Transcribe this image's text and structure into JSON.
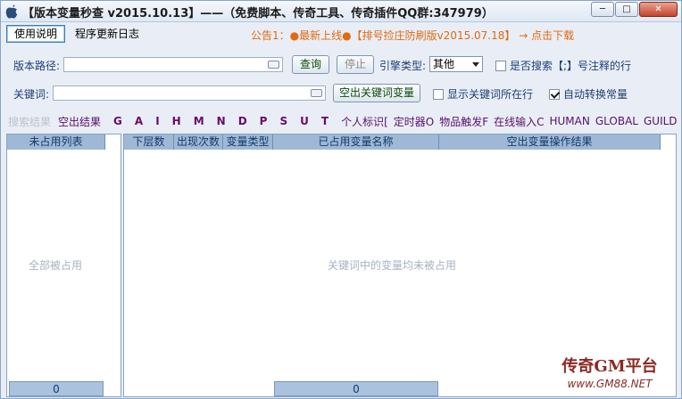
{
  "window": {
    "title": "【版本变量秒查 v2015.10.13】——（免费脚本、传奇工具、传奇插件QQ群:347979）",
    "minimize_label": "─",
    "maximize_label": "□",
    "close_label": "✕"
  },
  "tabs": [
    {
      "label": "使用说明",
      "active": true
    },
    {
      "label": "程序更新日志",
      "active": false
    }
  ],
  "notice": "公告1：●最新上线●【排号捡庄防刷版v2015.07.18】 → 点击下载",
  "form": {
    "version_path_label": "版本路径:",
    "version_path_value": "",
    "query_button": "查询",
    "stop_button": "停止",
    "engine_type_label": "引擎类型:",
    "engine_type_selected": "其他",
    "search_comment_label": "是否搜索【;】号注释的行",
    "search_comment_checked": false,
    "keyword_label": "关键词:",
    "keyword_value": "",
    "empty_keyword_button": "空出关键词变量",
    "show_line_label": "显示关键词所在行",
    "show_line_checked": false,
    "auto_convert_label": "自动转换常量",
    "auto_convert_checked": true
  },
  "results_bar": {
    "header": "搜索结果",
    "items": [
      "空出结果",
      "G",
      "A",
      "I",
      "H",
      "M",
      "N",
      "D",
      "P",
      "S",
      "U",
      "T",
      "个人标识[",
      "定时器O",
      "物品触发F",
      "在线输入C",
      "HUMAN",
      "GLOBAL",
      "GUILD"
    ]
  },
  "left_panel": {
    "header": "未占用列表",
    "empty_message": "全部被占用",
    "footer_count": "0"
  },
  "right_panel": {
    "columns": [
      "下层数",
      "出现次数",
      "变量类型",
      "已占用变量名称",
      "空出变量操作结果"
    ],
    "empty_message": "关键词中的变量均未被占用",
    "footer_count": "0"
  },
  "watermark": {
    "line1": "传奇GM平台",
    "line2": "www.GM88.NET"
  },
  "colors": {
    "title_bar": "#dfe8f3",
    "header_blue": "#9fb8d6",
    "notice_orange": "#e06a10",
    "result_purple": "#6a0a6a"
  }
}
